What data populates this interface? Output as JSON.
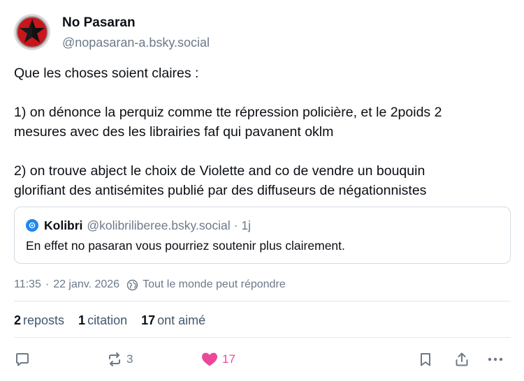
{
  "author": {
    "display_name": "No Pasaran",
    "handle": "@nopasaran-a.bsky.social",
    "avatar_icon": "red-black-star-icon"
  },
  "post": {
    "lines": [
      "Que les choses soient claires :",
      "",
      "1) on dénonce la perquiz comme tte répression policière, et le 2poids 2",
      "mesures avec des les librairies faf qui pavanent oklm",
      "",
      "2) on trouve abject le choix de Violette and co de vendre un bouquin",
      "glorifiant des antisémites publié par des diffuseurs de négationnistes"
    ]
  },
  "quote": {
    "author": "Kolibri",
    "handle": "@kolibriliberee.bsky.social",
    "separator": "·",
    "time": "1j",
    "text": "En effet no pasaran vous pourriez soutenir plus clairement."
  },
  "meta": {
    "time": "11:35",
    "separator": "·",
    "date": "22 janv. 2026",
    "reply_setting": "Tout le monde peut répondre"
  },
  "stats": {
    "reposts_count": "2",
    "reposts_label": "reposts",
    "quotes_count": "1",
    "quotes_label": "citation",
    "likes_count": "17",
    "likes_label": "ont aimé"
  },
  "actions": {
    "repost_count": "3",
    "like_count": "17"
  },
  "colors": {
    "like_accent": "#ec4899",
    "quote_avatar": "#1e88f0",
    "muted_text": "#6c7a89"
  }
}
